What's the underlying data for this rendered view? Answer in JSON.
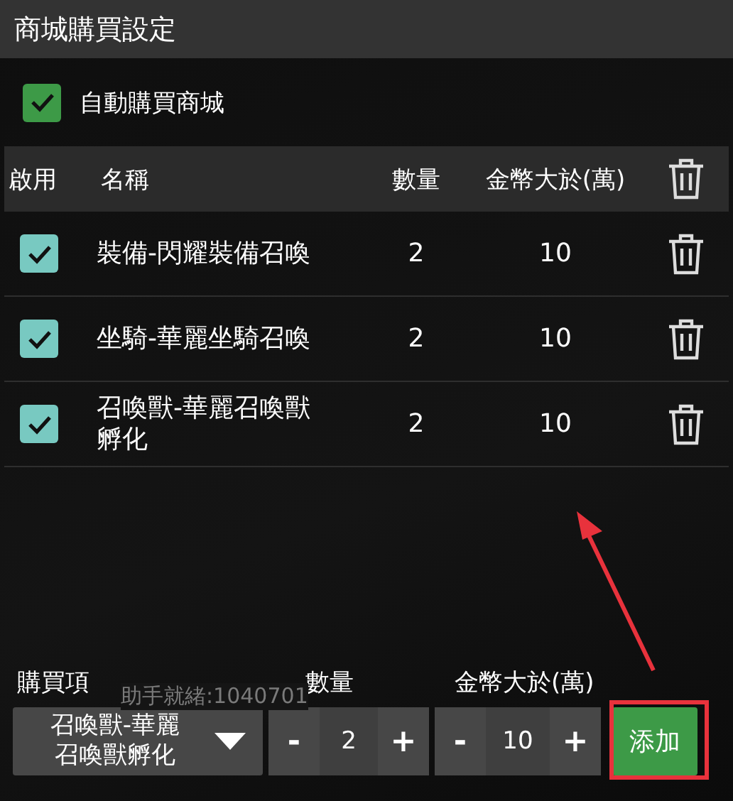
{
  "window": {
    "title": "商城購買設定"
  },
  "auto_buy": {
    "label": "自動購買商城",
    "checked": true
  },
  "table": {
    "columns": [
      "啟用",
      "名稱",
      "數量",
      "金幣大於(萬)"
    ],
    "rows": [
      {
        "enabled": true,
        "name": "裝備-閃耀裝備召喚",
        "quantity": "2",
        "gold": "10"
      },
      {
        "enabled": true,
        "name": "坐騎-華麗坐騎召喚",
        "quantity": "2",
        "gold": "10"
      },
      {
        "enabled": true,
        "name": "召喚獸-華麗召喚獸孵化",
        "quantity": "2",
        "gold": "10"
      }
    ]
  },
  "background_status": "助手就緒:1040701",
  "add_form": {
    "item_label": "購買項",
    "quantity_label": "數量",
    "gold_label": "金幣大於(萬)",
    "item_select": {
      "value": "召喚獸-華麗召喚獸孵化"
    },
    "quantity": {
      "minus": "-",
      "value": "2",
      "plus": "+"
    },
    "gold": {
      "minus": "-",
      "value": "10",
      "plus": "+"
    },
    "add_button": "添加"
  }
}
